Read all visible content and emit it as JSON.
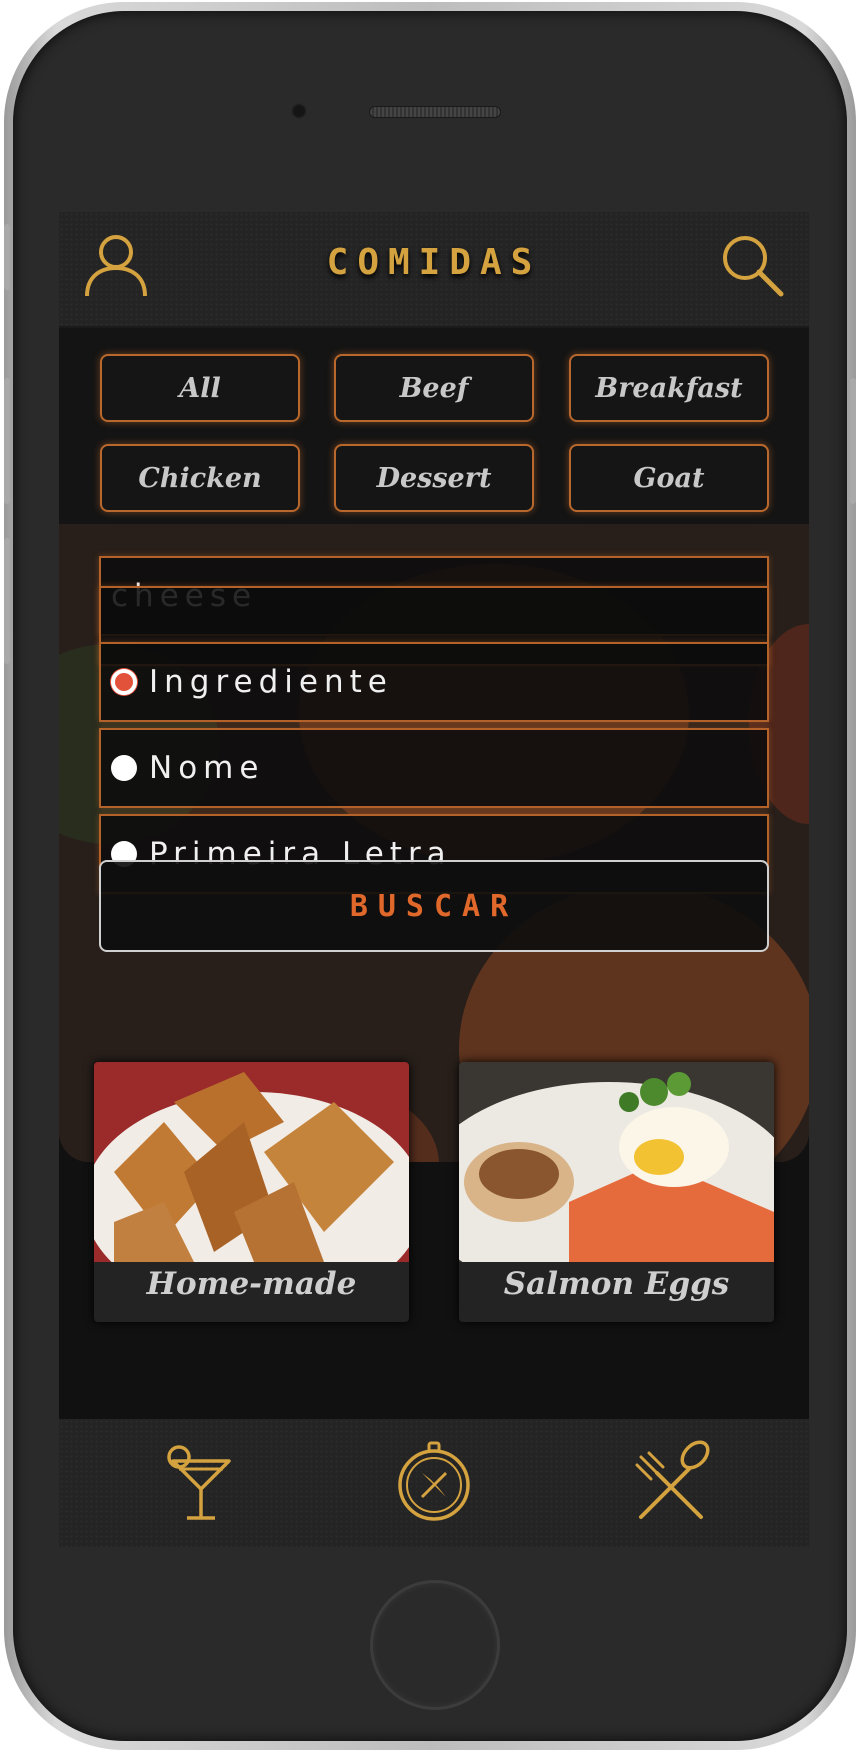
{
  "header": {
    "title": "COMIDAS",
    "profile_icon": "user-icon",
    "search_icon": "search-icon"
  },
  "filters": [
    "All",
    "Beef",
    "Breakfast",
    "Chicken",
    "Dessert",
    "Goat"
  ],
  "search": {
    "value": "cheese",
    "options": [
      {
        "label": "Ingrediente",
        "checked": true
      },
      {
        "label": "Nome",
        "checked": false
      },
      {
        "label": "Primeira Letra",
        "checked": false
      }
    ],
    "button_label": "BUSCAR"
  },
  "cards": [
    {
      "title": "Home-made"
    },
    {
      "title": "Salmon Eggs"
    }
  ],
  "footer": {
    "icons": [
      "cocktail-icon",
      "compass-icon",
      "fork-spoon-icon"
    ]
  },
  "colors": {
    "accent_gold": "#d4a23f",
    "accent_orange": "#e0682a",
    "border_orange": "#b8682c",
    "radio_selected": "#e2513a"
  }
}
